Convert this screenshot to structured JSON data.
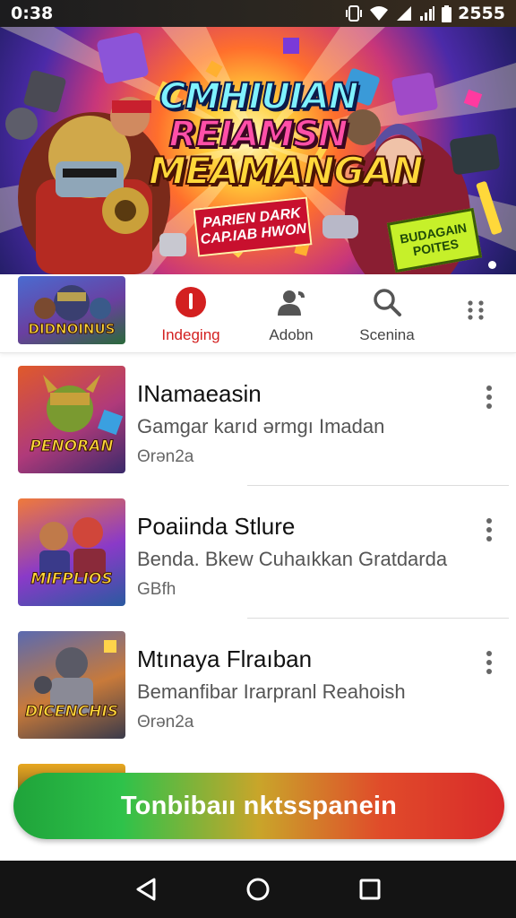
{
  "status_bar": {
    "time": "0:38",
    "battery": "2555"
  },
  "banner": {
    "title_line1": "CMHIUIAN",
    "title_line2": "REIAMSN",
    "title_line3": "MEAMANGAN",
    "subtitle_line1": "PARIEN DARK",
    "subtitle_line2": "CAP.IAB HWON",
    "tag_line1": "BUDAGAIN",
    "tag_line2": "POITES"
  },
  "tabs": {
    "thumb_text": "DIDNOINUS",
    "items": [
      {
        "label": "Indeging",
        "icon": "record-icon",
        "active": true
      },
      {
        "label": "Adobn",
        "icon": "user-icon",
        "active": false
      },
      {
        "label": "Scenina",
        "icon": "search-icon",
        "active": false
      }
    ]
  },
  "list": {
    "items": [
      {
        "title": "INamaeasin",
        "subtitle": "Gamgar karıd ərmgı Imadan",
        "meta": "Θrən2a",
        "thumb_text": "PENORAN"
      },
      {
        "title": "Poaiinda Stlure",
        "subtitle": "Benda. Bkew Cuhaıkkan Gratdarda",
        "meta": "GBfh",
        "thumb_text": "MIFPLIOS"
      },
      {
        "title": "Mtınaya Flraıban",
        "subtitle": "Bemanfibar Irarpranl Reahoish",
        "meta": "Θrən2a",
        "thumb_text": "DICENCHIS"
      }
    ]
  },
  "cta": {
    "label": "Tonbibaıı nktsspanein"
  },
  "colors": {
    "accent_red": "#d32020",
    "cta_green": "#2ec24a",
    "cta_red": "#d92a2a"
  }
}
